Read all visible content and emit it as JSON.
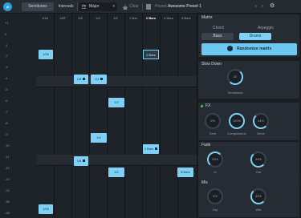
{
  "topbar": {
    "semitones": "Semitones",
    "intervals": "Intervals",
    "scale": "Major",
    "clear": "Clear",
    "preset_label": "Preset",
    "preset_name": "Awesome Preset 1"
  },
  "grid": {
    "columns": [
      "1/16",
      "1/8T",
      "1/8",
      "1/4",
      "1/2",
      "1 Bar",
      "2 Bars",
      "4 Bars",
      "8 Bars"
    ],
    "rows": [
      "+1",
      "0",
      "-1",
      "-2",
      "-3",
      "-4",
      "-5",
      "-6",
      "-7",
      "-8",
      "-9",
      "-10",
      "-11",
      "-12",
      "-13",
      "-24",
      "-36",
      "-48"
    ],
    "cells": [
      {
        "label": "1/16"
      },
      {
        "label": "2 Bars"
      },
      {
        "label": "1/8"
      },
      {
        "label": "1/4"
      },
      {
        "label": "1/2"
      },
      {
        "label": "1/4"
      },
      {
        "label": "2 Bars"
      },
      {
        "label": "1/8"
      },
      {
        "label": "1/2"
      },
      {
        "label": "8 Bars"
      },
      {
        "label": "1/16"
      }
    ]
  },
  "panel": {
    "matrix": {
      "title": "Matrix",
      "chord": "Chord",
      "arpeggio": "Arpeggio",
      "bass": "Bass",
      "drums": "Drums",
      "randomize": "Randomize matrix"
    },
    "slowdown": {
      "title": "Slow Down",
      "value": "22",
      "label": "Semitones"
    },
    "fx": {
      "title": "FX",
      "knobs": [
        {
          "value": "0%",
          "label": "Tone"
        },
        {
          "value": "100%",
          "label": "Compression"
        },
        {
          "value": "44%",
          "label": "Drive"
        }
      ]
    },
    "fade": {
      "title": "Fade",
      "knobs": [
        {
          "value": "33%",
          "label": "In"
        },
        {
          "value": "44%",
          "label": "Out"
        }
      ]
    },
    "mix": {
      "title": "Mix",
      "knobs": [
        {
          "value": "0%",
          "label": "Dry"
        },
        {
          "value": "44%",
          "label": "Wet"
        }
      ]
    }
  }
}
